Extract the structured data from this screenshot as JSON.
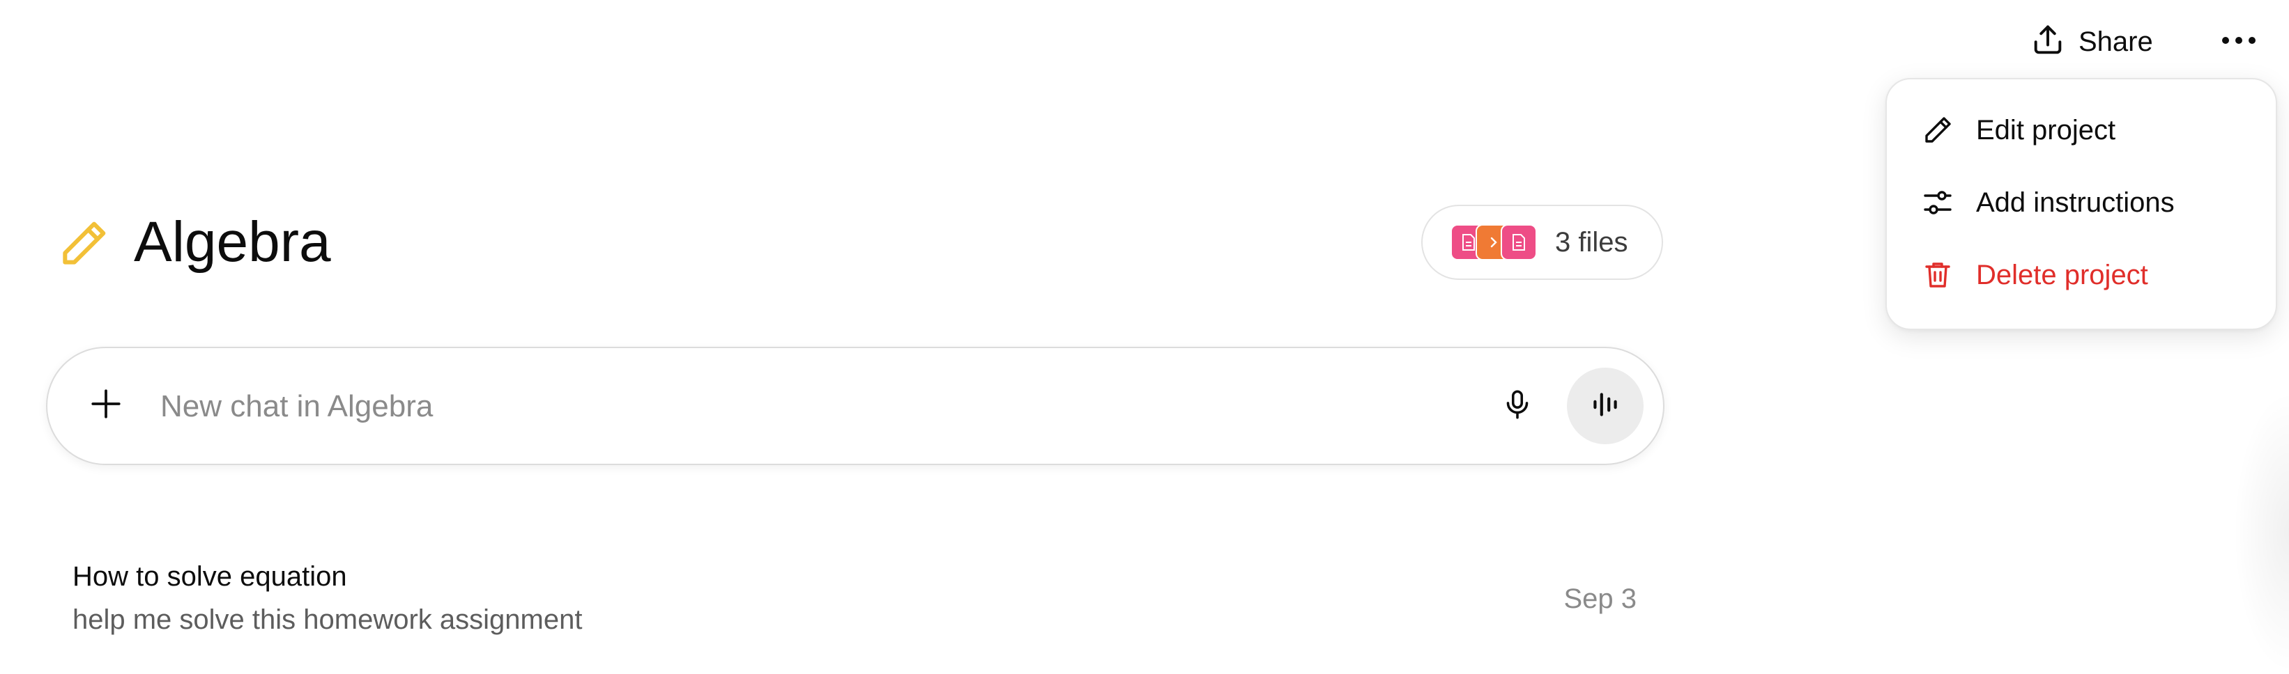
{
  "header": {
    "share_label": "Share",
    "share_icon": "share-icon",
    "more_icon": "more-dots-icon"
  },
  "menu": {
    "items": [
      {
        "label": "Edit project",
        "icon": "pencil-icon"
      },
      {
        "label": "Add instructions",
        "icon": "sliders-icon"
      },
      {
        "label": "Delete project",
        "icon": "trash-icon",
        "color": "#e02e2a"
      }
    ]
  },
  "project": {
    "title": "Algebra",
    "icon": "pencil-icon",
    "icon_color": "#f2c037"
  },
  "files": {
    "count_label": "3 files",
    "colors": [
      "#ee4d86",
      "#f07a34",
      "#ee4d86"
    ]
  },
  "composer": {
    "placeholder": "New chat in Algebra",
    "value": ""
  },
  "conversations": [
    {
      "title": "How to solve equation",
      "snippet": "help me solve this homework assignment",
      "date": "Sep 3"
    }
  ]
}
